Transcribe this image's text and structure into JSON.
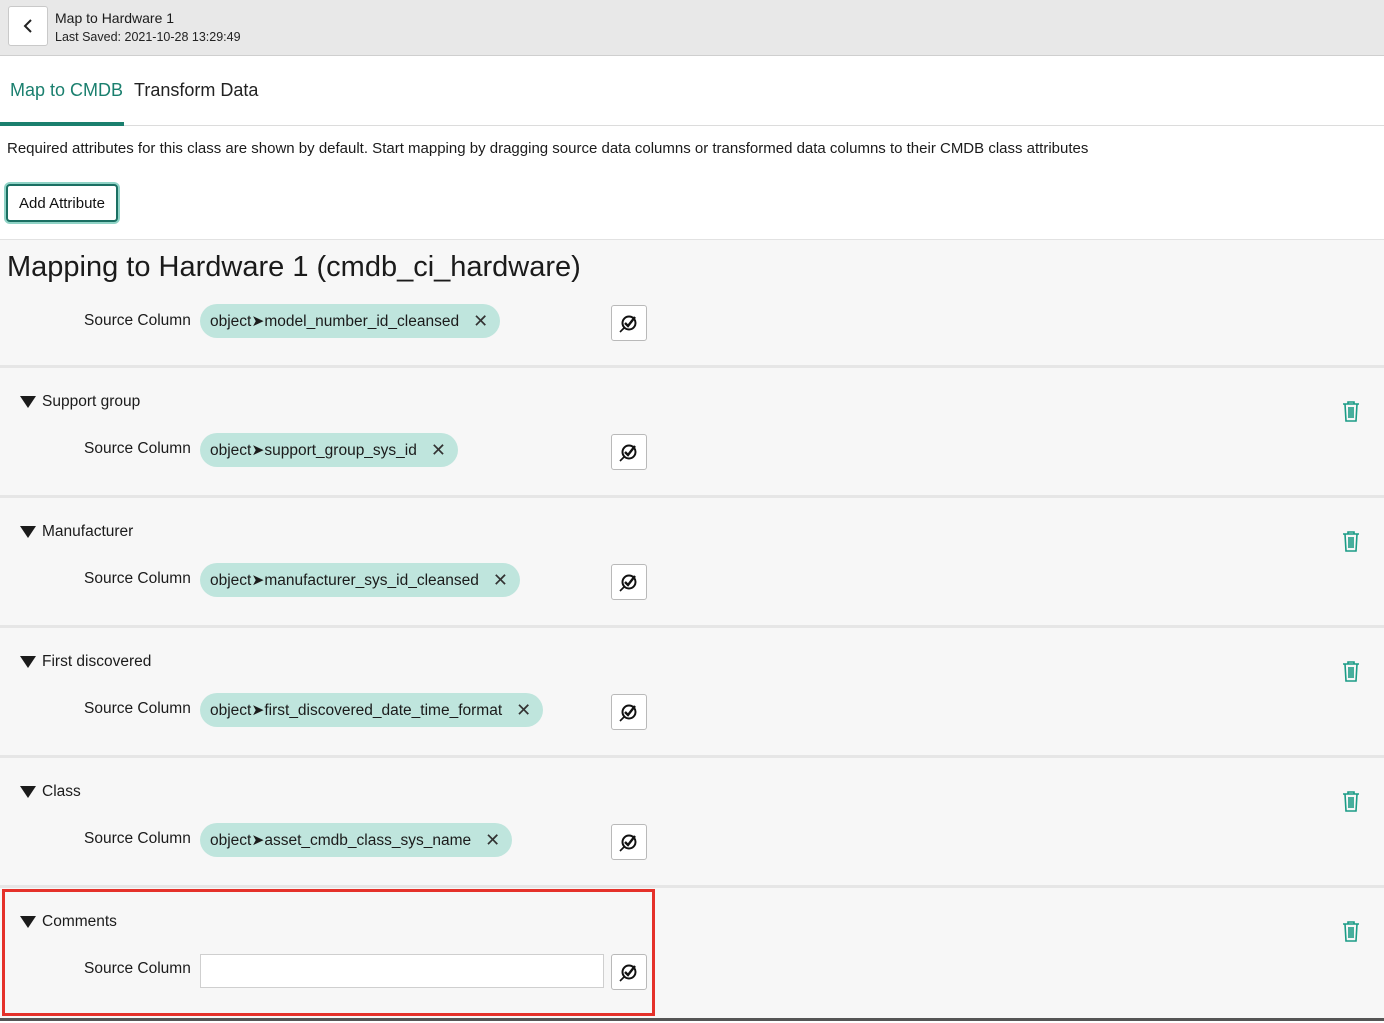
{
  "header": {
    "title": "Map to Hardware 1",
    "last_saved": "Last Saved: 2021-10-28 13:29:49"
  },
  "tabs": [
    {
      "label": "Map to CMDB",
      "active": true
    },
    {
      "label": "Transform Data",
      "active": false
    }
  ],
  "hint_text": "Required attributes for this class are shown by default. Start mapping by dragging source data columns or transformed data columns to their CMDB class attributes",
  "add_attribute_label": "Add Attribute",
  "section_title": "Mapping to Hardware 1 (cmdb_ci_hardware)",
  "source_column_label": "Source Column",
  "attributes": [
    {
      "name": "",
      "value": "object➤model_number_id_cleansed"
    },
    {
      "name": "Support group",
      "value": "object➤support_group_sys_id"
    },
    {
      "name": "Manufacturer",
      "value": "object➤manufacturer_sys_id_cleansed"
    },
    {
      "name": "First discovered",
      "value": "object➤first_discovered_date_time_format"
    },
    {
      "name": "Class",
      "value": "object➤asset_cmdb_class_sys_name"
    },
    {
      "name": "Comments",
      "value": ""
    }
  ],
  "colors": {
    "accent": "#1a7f6e",
    "chip": "#bfe5dd",
    "highlight": "#e5312a"
  },
  "icons": [
    "chevron-left-icon",
    "collapse-triangle-icon",
    "remove-x-icon",
    "transform-map-icon",
    "trash-icon"
  ]
}
